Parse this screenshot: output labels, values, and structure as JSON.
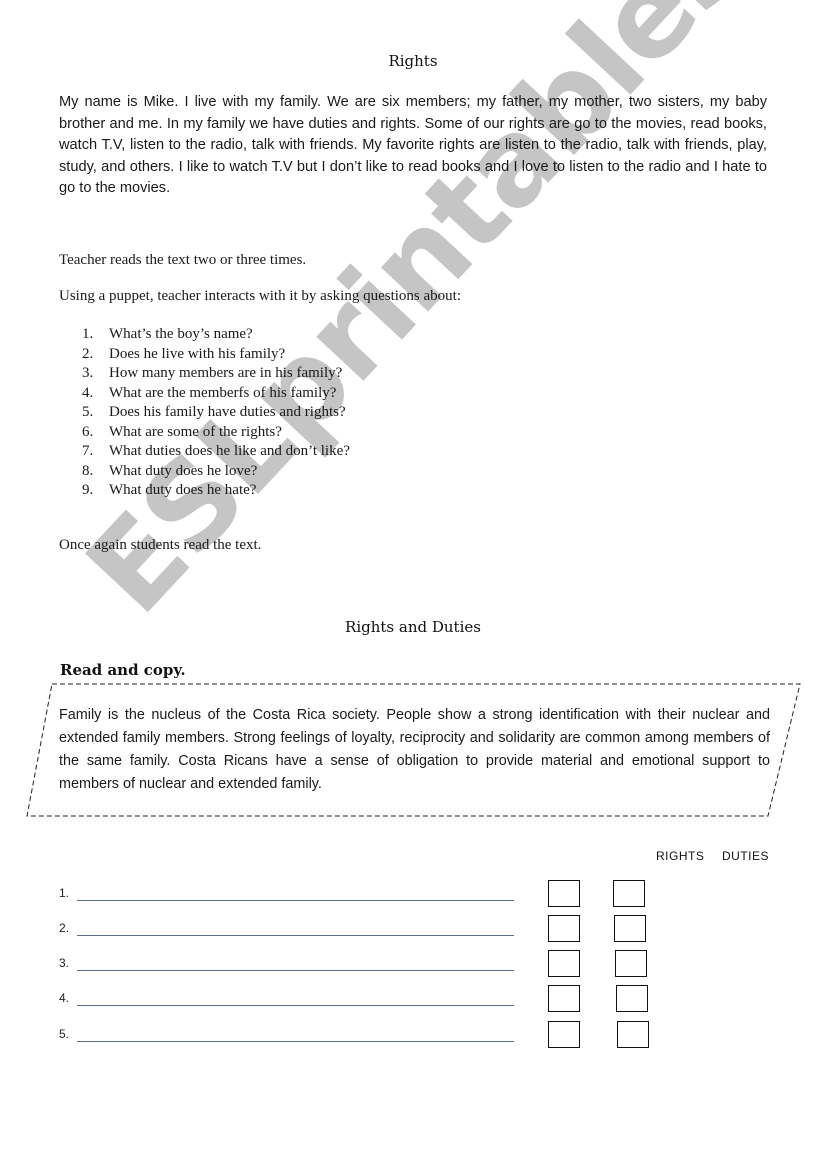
{
  "title": "Rights",
  "story": "My name is Mike.  I live with my family.  We are six members; my father, my mother, two sisters, my baby brother and me.  In my family we have duties and rights.  Some of our rights are go to the movies, read books, watch T.V, listen to the radio, talk with friends. My favorite rights are listen to the radio, talk with friends, play, study, and others.  I like to watch T.V but I don’t like  to read  books and I love to listen to the radio  and  I hate to go to the movies.",
  "instructions": {
    "step1": "Teacher reads the text two or three times.",
    "step2": "Using a puppet, teacher  interacts with it by asking questions about:",
    "step3": "Once again students read the text."
  },
  "questions": [
    {
      "num": "1.",
      "text": "What’s the boy’s name?"
    },
    {
      "num": "2.",
      "text": "Does he live with his family?"
    },
    {
      "num": "3.",
      "text": "How many members are in his family?"
    },
    {
      "num": "4.",
      "text": "What are the memberfs of his family?"
    },
    {
      "num": "5.",
      "text": "Does his family have duties and rights?"
    },
    {
      "num": "6.",
      "text": "What are some of the rights?"
    },
    {
      "num": "7.",
      "text": "What duties does he like and don’t like?"
    },
    {
      "num": "8.",
      "text": "What duty does he love?"
    },
    {
      "num": "9.",
      "text": "What duty does he hate?"
    }
  ],
  "section2": {
    "title": "Rights and Duties",
    "task": "Read and copy.",
    "passage": "Family is the nucleus of the Costa Rica society. People show a strong identification with their nuclear and extended family members. Strong feelings of loyalty, reciprocity and solidarity are common among members of the same family. Costa Ricans have a sense of obligation to provide material and emotional support to members of nuclear and extended family."
  },
  "table": {
    "col_rights": "RIGHTS",
    "col_duties": "DUTIES",
    "rows": [
      {
        "num": "1."
      },
      {
        "num": "2."
      },
      {
        "num": "3."
      },
      {
        "num": "4."
      },
      {
        "num": "5."
      }
    ]
  },
  "watermark": "ESLprintables.com"
}
